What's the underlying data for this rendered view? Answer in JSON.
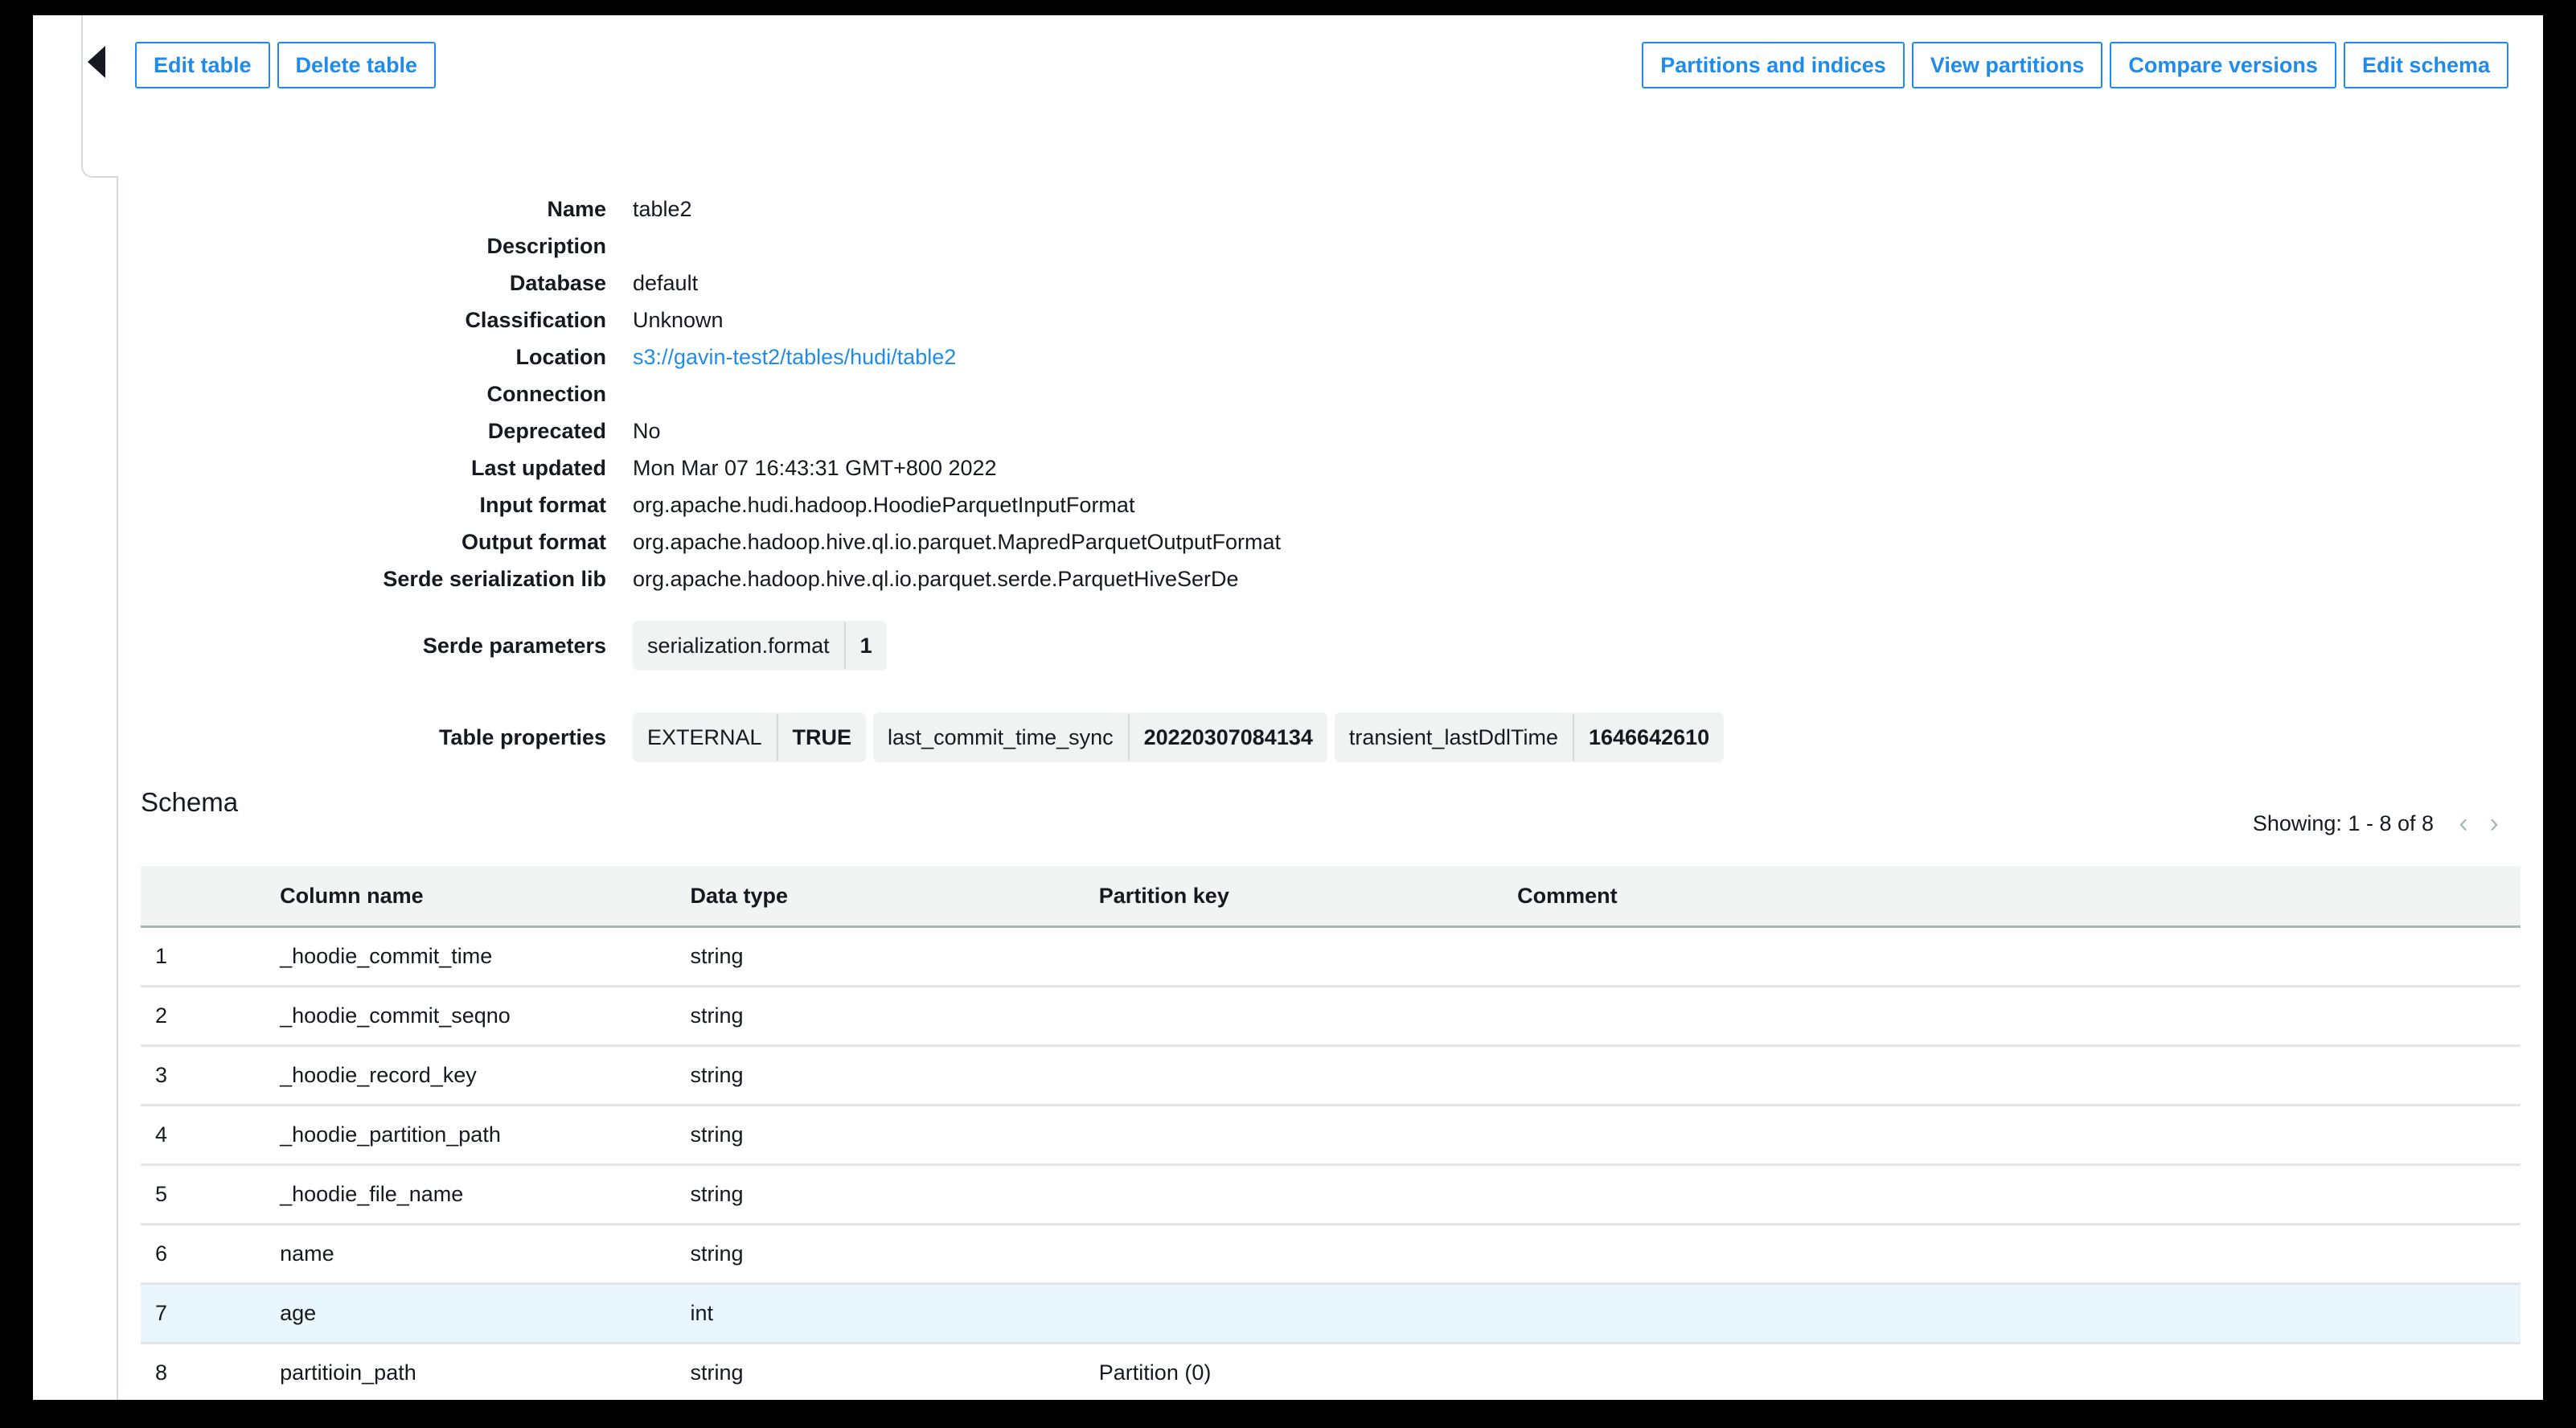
{
  "toolbar": {
    "left_buttons": [
      {
        "label": "Edit table",
        "name": "edit-table-button"
      },
      {
        "label": "Delete table",
        "name": "delete-table-button"
      }
    ],
    "right_buttons": [
      {
        "label": "Partitions and indices",
        "name": "partitions-and-indices-button"
      },
      {
        "label": "View partitions",
        "name": "view-partitions-button"
      },
      {
        "label": "Compare versions",
        "name": "compare-versions-button"
      },
      {
        "label": "Edit schema",
        "name": "edit-schema-button"
      }
    ]
  },
  "collapse_icon": "left-triangle-icon",
  "details": {
    "name_label": "Name",
    "name_value": "table2",
    "description_label": "Description",
    "description_value": "",
    "database_label": "Database",
    "database_value": "default",
    "classification_label": "Classification",
    "classification_value": "Unknown",
    "location_label": "Location",
    "location_value": "s3://gavin-test2/tables/hudi/table2",
    "connection_label": "Connection",
    "connection_value": "",
    "deprecated_label": "Deprecated",
    "deprecated_value": "No",
    "last_updated_label": "Last updated",
    "last_updated_value": "Mon Mar 07 16:43:31 GMT+800 2022",
    "input_format_label": "Input format",
    "input_format_value": "org.apache.hudi.hadoop.HoodieParquetInputFormat",
    "output_format_label": "Output format",
    "output_format_value": "org.apache.hadoop.hive.ql.io.parquet.MapredParquetOutputFormat",
    "serde_lib_label": "Serde serialization lib",
    "serde_lib_value": "org.apache.hadoop.hive.ql.io.parquet.serde.ParquetHiveSerDe",
    "serde_parameters_label": "Serde parameters",
    "serde_parameters": [
      {
        "key": "serialization.format",
        "value": "1"
      }
    ],
    "table_properties_label": "Table properties",
    "table_properties": [
      {
        "key": "EXTERNAL",
        "value": "TRUE"
      },
      {
        "key": "last_commit_time_sync",
        "value": "20220307084134"
      },
      {
        "key": "transient_lastDdlTime",
        "value": "1646642610"
      }
    ]
  },
  "schema": {
    "title": "Schema",
    "pager_text": "Showing: 1 - 8 of 8",
    "prev_icon": "chevron-left-icon",
    "next_icon": "chevron-right-icon",
    "columns": [
      "",
      "Column name",
      "Data type",
      "Partition key",
      "Comment"
    ],
    "rows": [
      {
        "idx": "1",
        "column_name": "_hoodie_commit_time",
        "data_type": "string",
        "partition_key": "",
        "comment": "",
        "selected": false
      },
      {
        "idx": "2",
        "column_name": "_hoodie_commit_seqno",
        "data_type": "string",
        "partition_key": "",
        "comment": "",
        "selected": false
      },
      {
        "idx": "3",
        "column_name": "_hoodie_record_key",
        "data_type": "string",
        "partition_key": "",
        "comment": "",
        "selected": false
      },
      {
        "idx": "4",
        "column_name": "_hoodie_partition_path",
        "data_type": "string",
        "partition_key": "",
        "comment": "",
        "selected": false
      },
      {
        "idx": "5",
        "column_name": "_hoodie_file_name",
        "data_type": "string",
        "partition_key": "",
        "comment": "",
        "selected": false
      },
      {
        "idx": "6",
        "column_name": "name",
        "data_type": "string",
        "partition_key": "",
        "comment": "",
        "selected": false
      },
      {
        "idx": "7",
        "column_name": "age",
        "data_type": "int",
        "partition_key": "",
        "comment": "",
        "selected": true
      },
      {
        "idx": "8",
        "column_name": "partitioin_path",
        "data_type": "string",
        "partition_key": "Partition (0)",
        "comment": "",
        "selected": false
      }
    ]
  },
  "colors": {
    "accent": "#1f8ceb",
    "text": "#16191f",
    "chip_bg": "#f1f3f3",
    "header_bg": "#f2f3f3",
    "row_selected_bg": "#eaf6fd",
    "border": "#e4e6e6"
  }
}
